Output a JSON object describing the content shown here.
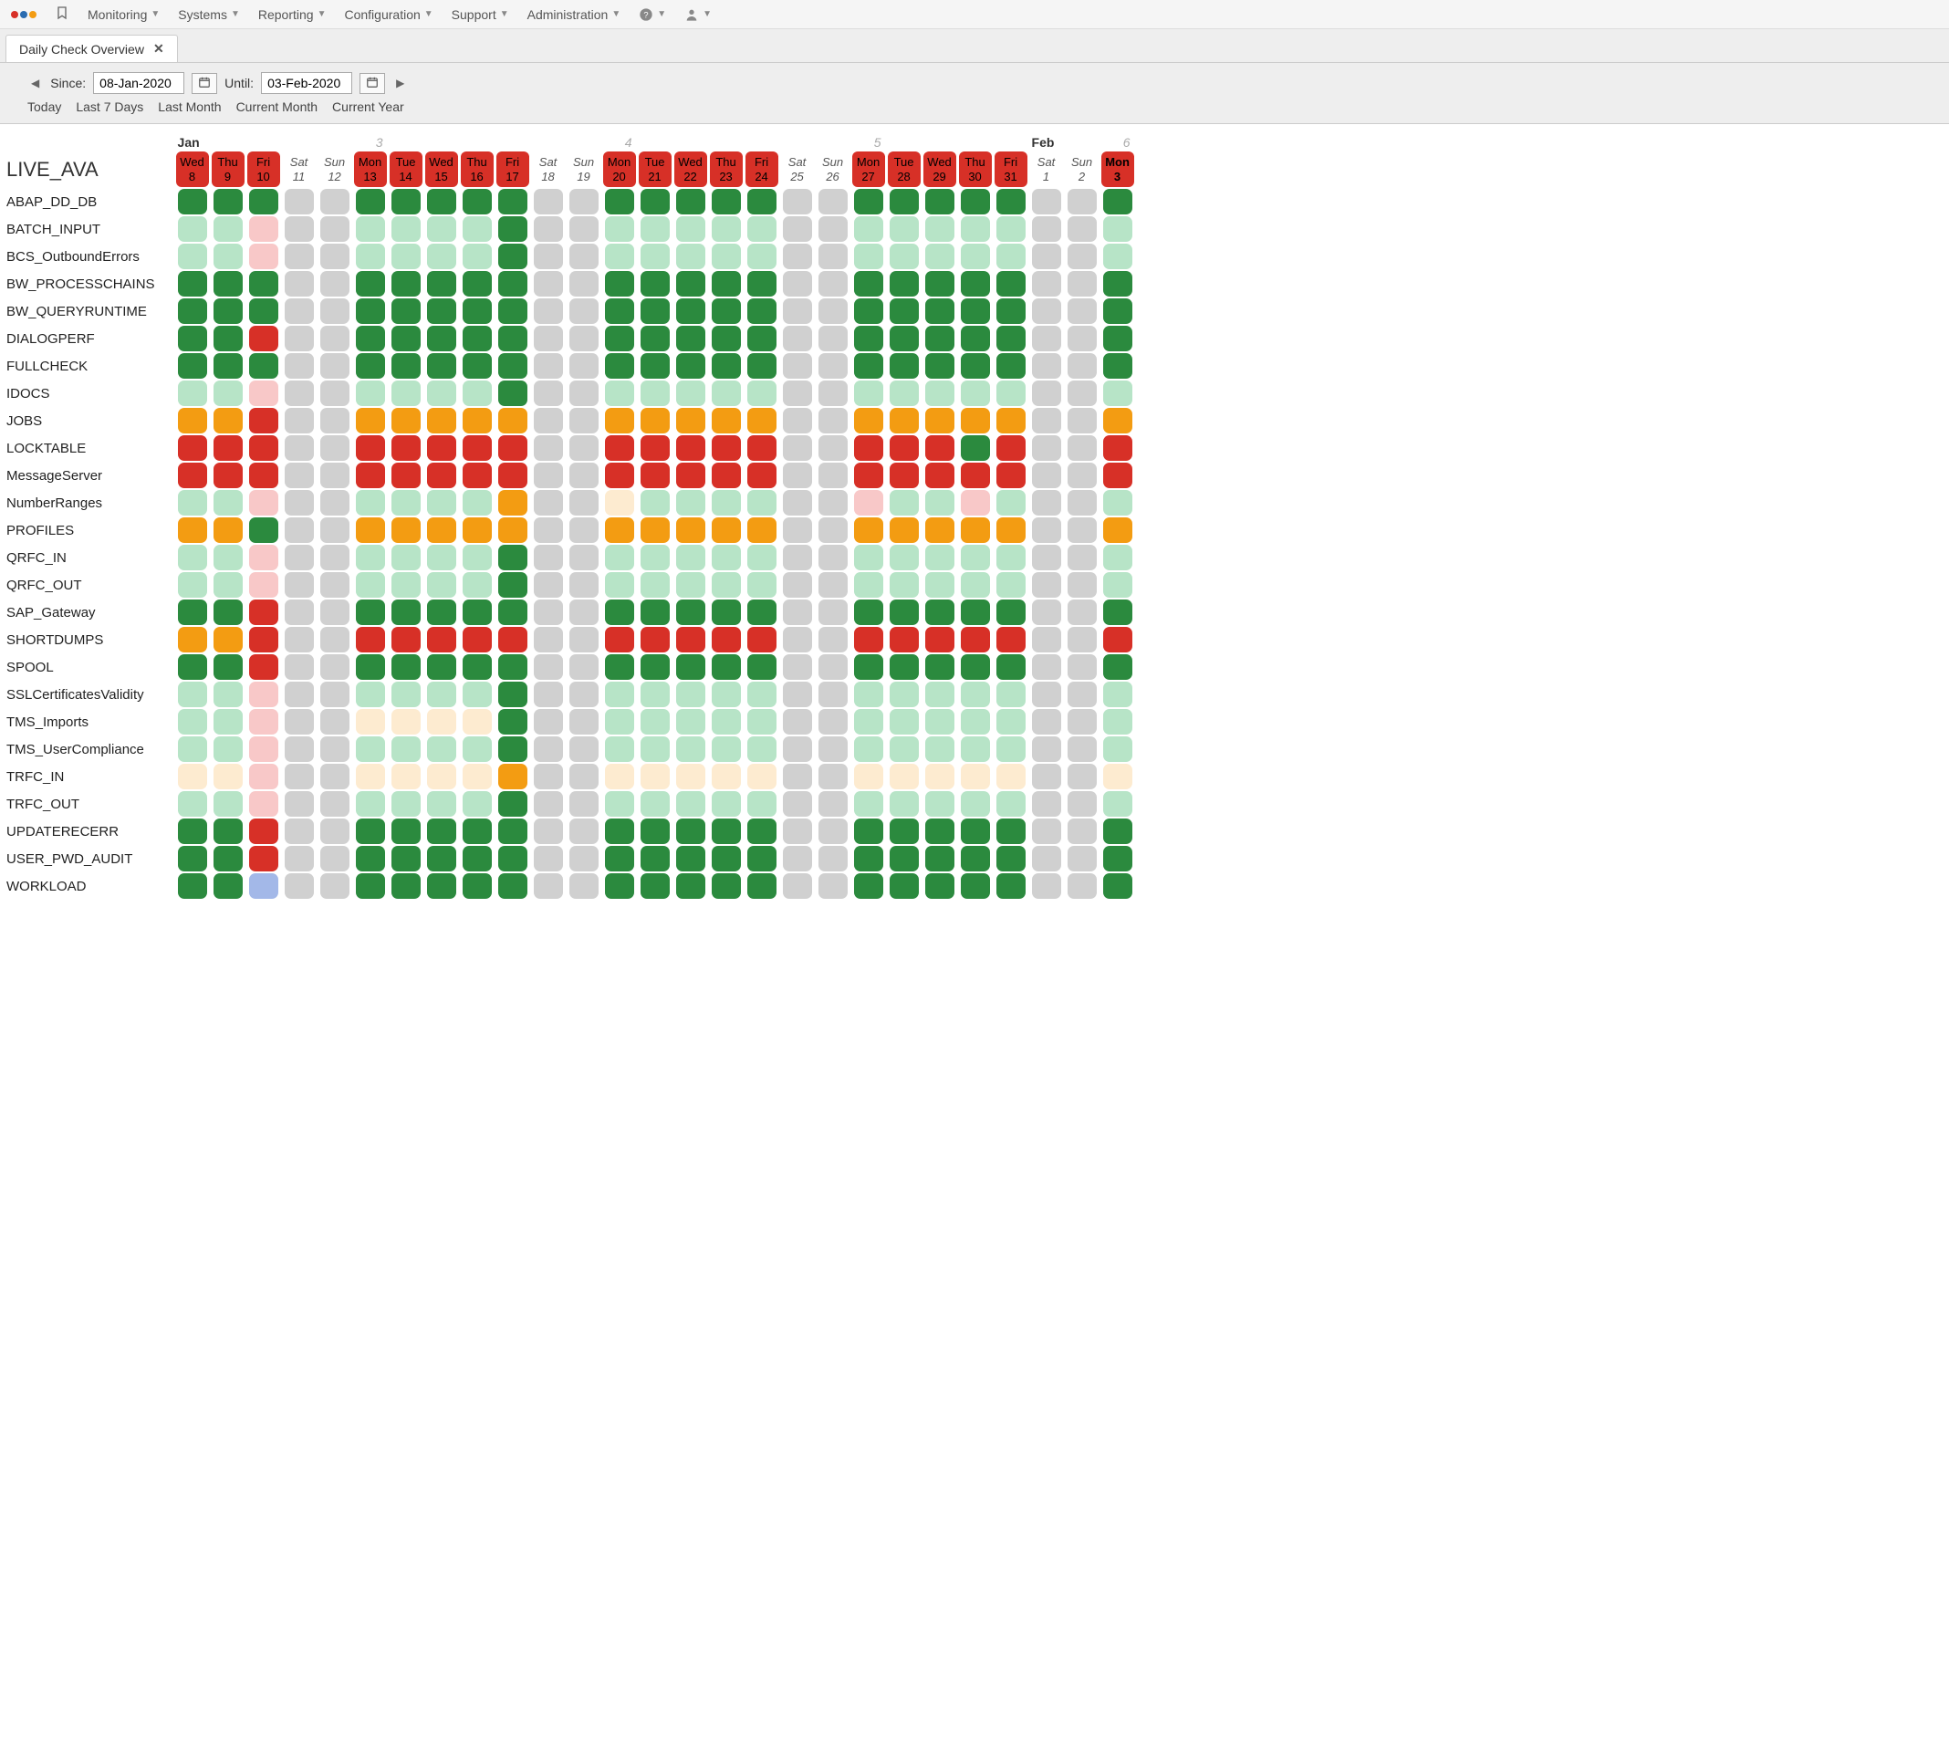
{
  "topbar": {
    "menus": [
      "Monitoring",
      "Systems",
      "Reporting",
      "Configuration",
      "Support",
      "Administration"
    ]
  },
  "tab": {
    "title": "Daily Check Overview"
  },
  "controls": {
    "since_label": "Since:",
    "since_value": "08-Jan-2020",
    "until_label": "Until:",
    "until_value": "03-Feb-2020",
    "quick": [
      "Today",
      "Last 7 Days",
      "Last Month",
      "Current Month",
      "Current Year"
    ]
  },
  "system": "LIVE_AVA",
  "months": [
    {
      "label": "Jan",
      "span_start": 0
    },
    {
      "label": "Feb",
      "span_start": 24
    }
  ],
  "week_numbers": [
    {
      "num": "3",
      "col": 5
    },
    {
      "num": "4",
      "col": 12
    },
    {
      "num": "5",
      "col": 19
    },
    {
      "num": "6",
      "col": 26
    }
  ],
  "days": [
    {
      "dow": "Wed",
      "dnum": "8",
      "hdr": "red"
    },
    {
      "dow": "Thu",
      "dnum": "9",
      "hdr": "red"
    },
    {
      "dow": "Fri",
      "dnum": "10",
      "hdr": "red"
    },
    {
      "dow": "Sat",
      "dnum": "11",
      "hdr": "weekend"
    },
    {
      "dow": "Sun",
      "dnum": "12",
      "hdr": "weekend"
    },
    {
      "dow": "Mon",
      "dnum": "13",
      "hdr": "red"
    },
    {
      "dow": "Tue",
      "dnum": "14",
      "hdr": "red"
    },
    {
      "dow": "Wed",
      "dnum": "15",
      "hdr": "red"
    },
    {
      "dow": "Thu",
      "dnum": "16",
      "hdr": "red"
    },
    {
      "dow": "Fri",
      "dnum": "17",
      "hdr": "red"
    },
    {
      "dow": "Sat",
      "dnum": "18",
      "hdr": "weekend"
    },
    {
      "dow": "Sun",
      "dnum": "19",
      "hdr": "weekend"
    },
    {
      "dow": "Mon",
      "dnum": "20",
      "hdr": "red"
    },
    {
      "dow": "Tue",
      "dnum": "21",
      "hdr": "red"
    },
    {
      "dow": "Wed",
      "dnum": "22",
      "hdr": "red"
    },
    {
      "dow": "Thu",
      "dnum": "23",
      "hdr": "red"
    },
    {
      "dow": "Fri",
      "dnum": "24",
      "hdr": "red"
    },
    {
      "dow": "Sat",
      "dnum": "25",
      "hdr": "weekend"
    },
    {
      "dow": "Sun",
      "dnum": "26",
      "hdr": "weekend"
    },
    {
      "dow": "Mon",
      "dnum": "27",
      "hdr": "red"
    },
    {
      "dow": "Tue",
      "dnum": "28",
      "hdr": "red"
    },
    {
      "dow": "Wed",
      "dnum": "29",
      "hdr": "red"
    },
    {
      "dow": "Thu",
      "dnum": "30",
      "hdr": "red"
    },
    {
      "dow": "Fri",
      "dnum": "31",
      "hdr": "red"
    },
    {
      "dow": "Sat",
      "dnum": "1",
      "hdr": "weekend"
    },
    {
      "dow": "Sun",
      "dnum": "2",
      "hdr": "weekend"
    },
    {
      "dow": "Mon",
      "dnum": "3",
      "hdr": "red today"
    }
  ],
  "checks": [
    {
      "name": "ABAP_DD_DB",
      "cells": [
        "g",
        "g",
        "g",
        "gy",
        "gy",
        "g",
        "g",
        "g",
        "g",
        "g",
        "gy",
        "gy",
        "g",
        "g",
        "g",
        "g",
        "g",
        "gy",
        "gy",
        "g",
        "g",
        "g",
        "g",
        "g",
        "gy",
        "gy",
        "g"
      ]
    },
    {
      "name": "BATCH_INPUT",
      "cells": [
        "lg",
        "lg",
        "lr",
        "gy",
        "gy",
        "lg",
        "lg",
        "lg",
        "lg",
        "g",
        "gy",
        "gy",
        "lg",
        "lg",
        "lg",
        "lg",
        "lg",
        "gy",
        "gy",
        "lg",
        "lg",
        "lg",
        "lg",
        "lg",
        "gy",
        "gy",
        "lg"
      ]
    },
    {
      "name": "BCS_OutboundErrors",
      "cells": [
        "lg",
        "lg",
        "lr",
        "gy",
        "gy",
        "lg",
        "lg",
        "lg",
        "lg",
        "g",
        "gy",
        "gy",
        "lg",
        "lg",
        "lg",
        "lg",
        "lg",
        "gy",
        "gy",
        "lg",
        "lg",
        "lg",
        "lg",
        "lg",
        "gy",
        "gy",
        "lg"
      ]
    },
    {
      "name": "BW_PROCESSCHAINS",
      "cells": [
        "g",
        "g",
        "g",
        "gy",
        "gy",
        "g",
        "g",
        "g",
        "g",
        "g",
        "gy",
        "gy",
        "g",
        "g",
        "g",
        "g",
        "g",
        "gy",
        "gy",
        "g",
        "g",
        "g",
        "g",
        "g",
        "gy",
        "gy",
        "g"
      ]
    },
    {
      "name": "BW_QUERYRUNTIME",
      "cells": [
        "g",
        "g",
        "g",
        "gy",
        "gy",
        "g",
        "g",
        "g",
        "g",
        "g",
        "gy",
        "gy",
        "g",
        "g",
        "g",
        "g",
        "g",
        "gy",
        "gy",
        "g",
        "g",
        "g",
        "g",
        "g",
        "gy",
        "gy",
        "g"
      ]
    },
    {
      "name": "DIALOGPERF",
      "cells": [
        "g",
        "g",
        "r",
        "gy",
        "gy",
        "g",
        "g",
        "g",
        "g",
        "g",
        "gy",
        "gy",
        "g",
        "g",
        "g",
        "g",
        "g",
        "gy",
        "gy",
        "g",
        "g",
        "g",
        "g",
        "g",
        "gy",
        "gy",
        "g"
      ]
    },
    {
      "name": "FULLCHECK",
      "cells": [
        "g",
        "g",
        "g",
        "gy",
        "gy",
        "g",
        "g",
        "g",
        "g",
        "g",
        "gy",
        "gy",
        "g",
        "g",
        "g",
        "g",
        "g",
        "gy",
        "gy",
        "g",
        "g",
        "g",
        "g",
        "g",
        "gy",
        "gy",
        "g"
      ]
    },
    {
      "name": "IDOCS",
      "cells": [
        "lg",
        "lg",
        "lr",
        "gy",
        "gy",
        "lg",
        "lg",
        "lg",
        "lg",
        "g",
        "gy",
        "gy",
        "lg",
        "lg",
        "lg",
        "lg",
        "lg",
        "gy",
        "gy",
        "lg",
        "lg",
        "lg",
        "lg",
        "lg",
        "gy",
        "gy",
        "lg"
      ]
    },
    {
      "name": "JOBS",
      "cells": [
        "o",
        "o",
        "r",
        "gy",
        "gy",
        "o",
        "o",
        "o",
        "o",
        "o",
        "gy",
        "gy",
        "o",
        "o",
        "o",
        "o",
        "o",
        "gy",
        "gy",
        "o",
        "o",
        "o",
        "o",
        "o",
        "gy",
        "gy",
        "o"
      ]
    },
    {
      "name": "LOCKTABLE",
      "cells": [
        "r",
        "r",
        "r",
        "gy",
        "gy",
        "r",
        "r",
        "r",
        "r",
        "r",
        "gy",
        "gy",
        "r",
        "r",
        "r",
        "r",
        "r",
        "gy",
        "gy",
        "r",
        "r",
        "r",
        "g",
        "r",
        "gy",
        "gy",
        "r"
      ]
    },
    {
      "name": "MessageServer",
      "cells": [
        "r",
        "r",
        "r",
        "gy",
        "gy",
        "r",
        "r",
        "r",
        "r",
        "r",
        "gy",
        "gy",
        "r",
        "r",
        "r",
        "r",
        "r",
        "gy",
        "gy",
        "r",
        "r",
        "r",
        "r",
        "r",
        "gy",
        "gy",
        "r"
      ]
    },
    {
      "name": "NumberRanges",
      "cells": [
        "lg",
        "lg",
        "lr",
        "gy",
        "gy",
        "lg",
        "lg",
        "lg",
        "lg",
        "o",
        "gy",
        "gy",
        "lo",
        "lg",
        "lg",
        "lg",
        "lg",
        "gy",
        "gy",
        "lr",
        "lg",
        "lg",
        "lr",
        "lg",
        "gy",
        "gy",
        "lg"
      ]
    },
    {
      "name": "PROFILES",
      "cells": [
        "o",
        "o",
        "g",
        "gy",
        "gy",
        "o",
        "o",
        "o",
        "o",
        "o",
        "gy",
        "gy",
        "o",
        "o",
        "o",
        "o",
        "o",
        "gy",
        "gy",
        "o",
        "o",
        "o",
        "o",
        "o",
        "gy",
        "gy",
        "o"
      ]
    },
    {
      "name": "QRFC_IN",
      "cells": [
        "lg",
        "lg",
        "lr",
        "gy",
        "gy",
        "lg",
        "lg",
        "lg",
        "lg",
        "g",
        "gy",
        "gy",
        "lg",
        "lg",
        "lg",
        "lg",
        "lg",
        "gy",
        "gy",
        "lg",
        "lg",
        "lg",
        "lg",
        "lg",
        "gy",
        "gy",
        "lg"
      ]
    },
    {
      "name": "QRFC_OUT",
      "cells": [
        "lg",
        "lg",
        "lr",
        "gy",
        "gy",
        "lg",
        "lg",
        "lg",
        "lg",
        "g",
        "gy",
        "gy",
        "lg",
        "lg",
        "lg",
        "lg",
        "lg",
        "gy",
        "gy",
        "lg",
        "lg",
        "lg",
        "lg",
        "lg",
        "gy",
        "gy",
        "lg"
      ]
    },
    {
      "name": "SAP_Gateway",
      "cells": [
        "g",
        "g",
        "r",
        "gy",
        "gy",
        "g",
        "g",
        "g",
        "g",
        "g",
        "gy",
        "gy",
        "g",
        "g",
        "g",
        "g",
        "g",
        "gy",
        "gy",
        "g",
        "g",
        "g",
        "g",
        "g",
        "gy",
        "gy",
        "g"
      ]
    },
    {
      "name": "SHORTDUMPS",
      "cells": [
        "o",
        "o",
        "r",
        "gy",
        "gy",
        "r",
        "r",
        "r",
        "r",
        "r",
        "gy",
        "gy",
        "r",
        "r",
        "r",
        "r",
        "r",
        "gy",
        "gy",
        "r",
        "r",
        "r",
        "r",
        "r",
        "gy",
        "gy",
        "r"
      ]
    },
    {
      "name": "SPOOL",
      "cells": [
        "g",
        "g",
        "r",
        "gy",
        "gy",
        "g",
        "g",
        "g",
        "g",
        "g",
        "gy",
        "gy",
        "g",
        "g",
        "g",
        "g",
        "g",
        "gy",
        "gy",
        "g",
        "g",
        "g",
        "g",
        "g",
        "gy",
        "gy",
        "g"
      ]
    },
    {
      "name": "SSLCertificatesValidity",
      "cells": [
        "lg",
        "lg",
        "lr",
        "gy",
        "gy",
        "lg",
        "lg",
        "lg",
        "lg",
        "g",
        "gy",
        "gy",
        "lg",
        "lg",
        "lg",
        "lg",
        "lg",
        "gy",
        "gy",
        "lg",
        "lg",
        "lg",
        "lg",
        "lg",
        "gy",
        "gy",
        "lg"
      ]
    },
    {
      "name": "TMS_Imports",
      "cells": [
        "lg",
        "lg",
        "lr",
        "gy",
        "gy",
        "lo",
        "lo",
        "lo",
        "lo",
        "g",
        "gy",
        "gy",
        "lg",
        "lg",
        "lg",
        "lg",
        "lg",
        "gy",
        "gy",
        "lg",
        "lg",
        "lg",
        "lg",
        "lg",
        "gy",
        "gy",
        "lg"
      ]
    },
    {
      "name": "TMS_UserCompliance",
      "cells": [
        "lg",
        "lg",
        "lr",
        "gy",
        "gy",
        "lg",
        "lg",
        "lg",
        "lg",
        "g",
        "gy",
        "gy",
        "lg",
        "lg",
        "lg",
        "lg",
        "lg",
        "gy",
        "gy",
        "lg",
        "lg",
        "lg",
        "lg",
        "lg",
        "gy",
        "gy",
        "lg"
      ]
    },
    {
      "name": "TRFC_IN",
      "cells": [
        "lo",
        "lo",
        "lr",
        "gy",
        "gy",
        "lo",
        "lo",
        "lo",
        "lo",
        "o",
        "gy",
        "gy",
        "lo",
        "lo",
        "lo",
        "lo",
        "lo",
        "gy",
        "gy",
        "lo",
        "lo",
        "lo",
        "lo",
        "lo",
        "gy",
        "gy",
        "lo"
      ]
    },
    {
      "name": "TRFC_OUT",
      "cells": [
        "lg",
        "lg",
        "lr",
        "gy",
        "gy",
        "lg",
        "lg",
        "lg",
        "lg",
        "g",
        "gy",
        "gy",
        "lg",
        "lg",
        "lg",
        "lg",
        "lg",
        "gy",
        "gy",
        "lg",
        "lg",
        "lg",
        "lg",
        "lg",
        "gy",
        "gy",
        "lg"
      ]
    },
    {
      "name": "UPDATERECERR",
      "cells": [
        "g",
        "g",
        "r",
        "gy",
        "gy",
        "g",
        "g",
        "g",
        "g",
        "g",
        "gy",
        "gy",
        "g",
        "g",
        "g",
        "g",
        "g",
        "gy",
        "gy",
        "g",
        "g",
        "g",
        "g",
        "g",
        "gy",
        "gy",
        "g"
      ]
    },
    {
      "name": "USER_PWD_AUDIT",
      "cells": [
        "g",
        "g",
        "r",
        "gy",
        "gy",
        "g",
        "g",
        "g",
        "g",
        "g",
        "gy",
        "gy",
        "g",
        "g",
        "g",
        "g",
        "g",
        "gy",
        "gy",
        "g",
        "g",
        "g",
        "g",
        "g",
        "gy",
        "gy",
        "g"
      ]
    },
    {
      "name": "WORKLOAD",
      "cells": [
        "g",
        "g",
        "b",
        "gy",
        "gy",
        "g",
        "g",
        "g",
        "g",
        "g",
        "gy",
        "gy",
        "g",
        "g",
        "g",
        "g",
        "g",
        "gy",
        "gy",
        "g",
        "g",
        "g",
        "g",
        "g",
        "gy",
        "gy",
        "g"
      ]
    }
  ],
  "status_colors": {
    "g": "#2b8a3e",
    "lg": "#b7e4c7",
    "r": "#d73027",
    "lr": "#f8c8c8",
    "o": "#f39c12",
    "lo": "#fdebd0",
    "b": "#a3b8e8",
    "gy": "#d0d0d0"
  }
}
